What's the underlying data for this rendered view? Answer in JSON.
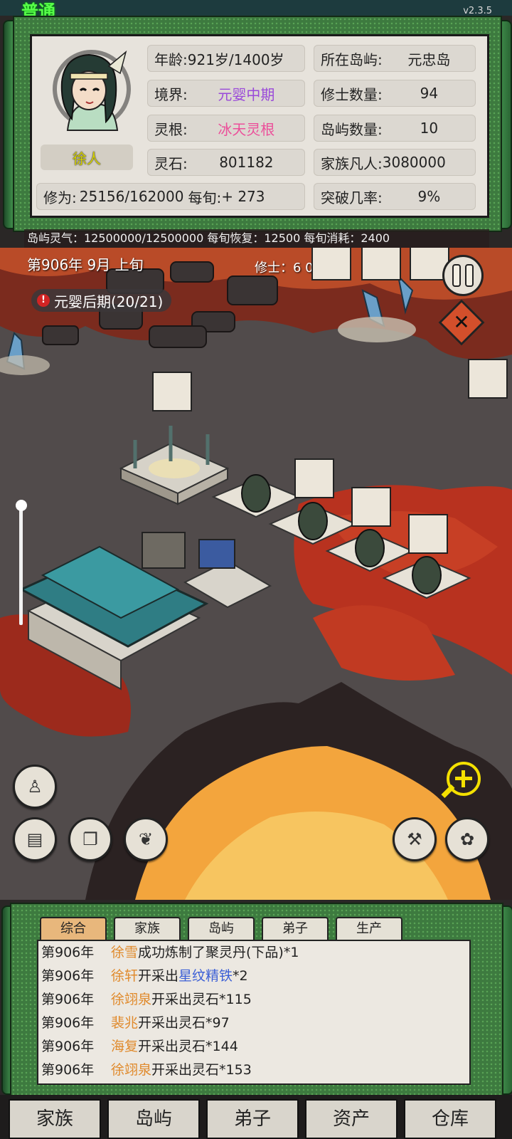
{
  "topbar": {
    "mode": "普通",
    "version": "v2.3.5"
  },
  "character": {
    "name": "徐人",
    "age_label": "年龄:",
    "age_value": "921岁/1400岁",
    "realm_label": "境界:",
    "realm_value": "元婴中期",
    "root_label": "灵根:",
    "root_value": "冰天灵根",
    "stone_label": "灵石:",
    "stone_value": "801182",
    "cultivation_label": "修为:",
    "cultivation_value": "25156/162000",
    "per_period_label": "每旬:",
    "per_period_value": "+ 273",
    "island_label": "所在岛屿:",
    "island_value": "元忠岛",
    "monks_label": "修士数量:",
    "monks_value": "94",
    "islands_label": "岛屿数量:",
    "islands_value": "10",
    "mortals_label": "家族凡人:",
    "mortals_value": "3080000",
    "breakthrough_label": "突破几率:",
    "breakthrough_value": "9%"
  },
  "island_bar": {
    "text": "岛屿灵气：12500000/12500000 每旬恢复：12500  每旬消耗：2400"
  },
  "scene": {
    "date": "第906年  9月  上旬",
    "cultivators": "修士：6  0空闲",
    "realm_goal": "元婴后期(20/21)",
    "warn_icon": "!"
  },
  "controls": {
    "pause": "pause-icon",
    "close": "✕"
  },
  "log": {
    "tabs": [
      "综合",
      "家族",
      "岛屿",
      "弟子",
      "生产"
    ],
    "entries": [
      {
        "year": "第906年",
        "name": "徐雪",
        "text": "成功炼制了聚灵丹(下品)*1",
        "item": "",
        "tail": ""
      },
      {
        "year": "第906年",
        "name": "徐轩",
        "text": "开采出",
        "item": "星纹精铁",
        "tail": "*2"
      },
      {
        "year": "第906年",
        "name": "徐翊泉",
        "text": "开采出灵石*115",
        "item": "",
        "tail": ""
      },
      {
        "year": "第906年",
        "name": "裴兆",
        "text": "开采出灵石*97",
        "item": "",
        "tail": ""
      },
      {
        "year": "第906年",
        "name": "海复",
        "text": "开采出灵石*144",
        "item": "",
        "tail": ""
      },
      {
        "year": "第906年",
        "name": "徐翊泉",
        "text": "开采出灵石*153",
        "item": "",
        "tail": ""
      }
    ]
  },
  "nav": [
    "家族",
    "岛屿",
    "弟子",
    "资产",
    "仓库"
  ]
}
